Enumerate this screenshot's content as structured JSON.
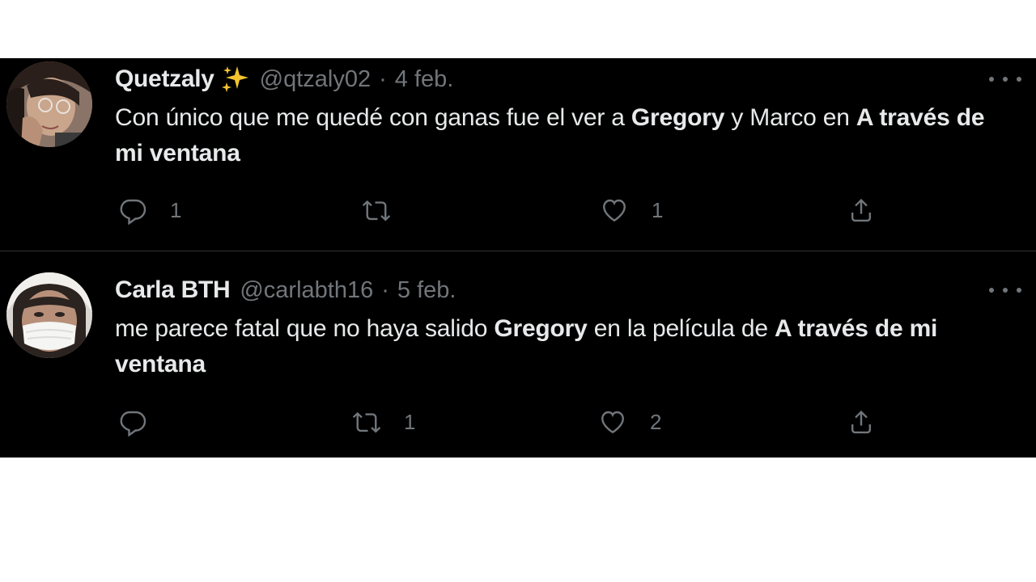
{
  "tweets": [
    {
      "name": "Quetzaly",
      "handle": "@qtzaly02",
      "separator": "·",
      "date": "4 feb.",
      "text_parts": {
        "p1": "Con único que me quedé con ganas fue el ver a ",
        "b1": "Gregory",
        "p2": " y Marco en ",
        "b2": "A través de mi ventana"
      },
      "replies": "1",
      "retweets": "",
      "likes": "1"
    },
    {
      "name": "Carla BTH",
      "handle": "@carlabth16",
      "separator": "·",
      "date": "5 feb.",
      "text_parts": {
        "p1": "me parece fatal que no haya salido ",
        "b1": "Gregory",
        "p2": " en la película de ",
        "b2": "A través de mi ventana"
      },
      "replies": "",
      "retweets": "1",
      "likes": "2"
    }
  ],
  "icons": {
    "reply": "reply-icon",
    "retweet": "retweet-icon",
    "like": "heart-icon",
    "share": "share-icon",
    "more": "more-icon",
    "emoji": "sparkles-icon"
  },
  "colors": {
    "background": "#000000",
    "text": "#e7e9ea",
    "secondary": "#71767b",
    "divider": "#2f3336",
    "sparkles": "#f4c430"
  }
}
